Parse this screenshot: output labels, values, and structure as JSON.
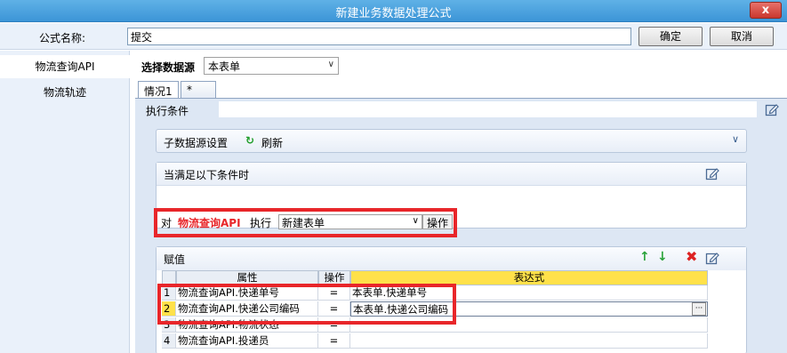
{
  "window": {
    "title": "新建业务数据处理公式",
    "close_label": "x"
  },
  "name_row": {
    "label": "公式名称:",
    "value": "提交",
    "ok_label": "确定",
    "cancel_label": "取消"
  },
  "sidebar": {
    "items": [
      {
        "label": "物流查询API",
        "active": true
      },
      {
        "label": "物流轨迹",
        "active": false
      }
    ]
  },
  "datasource": {
    "label": "选择数据源",
    "selected": "本表单"
  },
  "tabs": [
    {
      "label": "情况1"
    },
    {
      "label": "*"
    }
  ],
  "exec_condition": {
    "label": "执行条件",
    "value": ""
  },
  "sub_datasource": {
    "label": "子数据源设置",
    "refresh_label": "刷新"
  },
  "condition": {
    "header": "当满足以下条件时",
    "row": {
      "prefix": "对",
      "target": "物流查询API",
      "action_word": "执行",
      "operation": "新建表单",
      "op_button": "操作"
    }
  },
  "assign": {
    "header": "赋值",
    "columns": {
      "attr": "属性",
      "op": "操作",
      "expr": "表达式"
    },
    "rows": [
      {
        "num": "1",
        "attr": "物流查询API.快递单号",
        "op": "=",
        "expr": "本表单.快递单号"
      },
      {
        "num": "2",
        "attr": "物流查询API.快递公司编码",
        "op": "=",
        "expr": "本表单.快递公司编码"
      },
      {
        "num": "3",
        "attr": "物流查询API.物流状态",
        "op": "=",
        "expr": ""
      },
      {
        "num": "4",
        "attr": "物流查询API.投递员",
        "op": "=",
        "expr": ""
      }
    ],
    "ellipsis": "···"
  },
  "colors": {
    "accent_red": "#e8262a",
    "header_yellow": "#ffe14a",
    "titlebar": "#4aa3e0"
  }
}
